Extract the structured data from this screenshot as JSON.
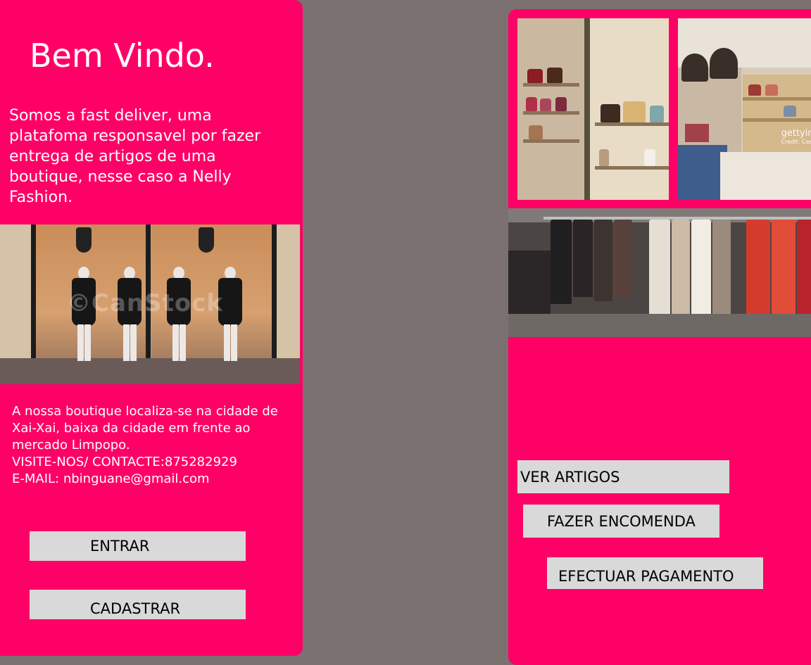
{
  "left_panel": {
    "title": "Bem Vindo.",
    "intro": "Somos a fast deliver, uma platafoma responsavel por fazer entrega de artigos de uma boutique, nesse caso a Nelly Fashion.",
    "info_lines": [
      "A nossa boutique localiza-se na cidade de Xai-Xai, baixa da cidade em frente ao mercado Limpopo.",
      "VISITE-NOS/ CONTACTE:875282929",
      "E-MAIL: nbinguane@gmail.com"
    ],
    "storefront_watermark": "©CanStock",
    "buttons": {
      "entrar": "ENTRAR",
      "cadastrar": "CADASTRAR"
    }
  },
  "right_panel": {
    "photo_watermark": "gettyima",
    "photo_credit": "Credit: Caso",
    "buttons": {
      "ver_artigos": "VER ARTIGOS",
      "fazer_encomenda": "FAZER  ENCOMENDA",
      "efectuar_pagamento": "EFECTUAR PAGAMENTO"
    }
  },
  "colors": {
    "panel_bg": "#ff0066",
    "page_bg": "#7a7170",
    "button_bg": "#d9d9d9",
    "text_light": "#ffffff",
    "text_dark": "#000000"
  }
}
